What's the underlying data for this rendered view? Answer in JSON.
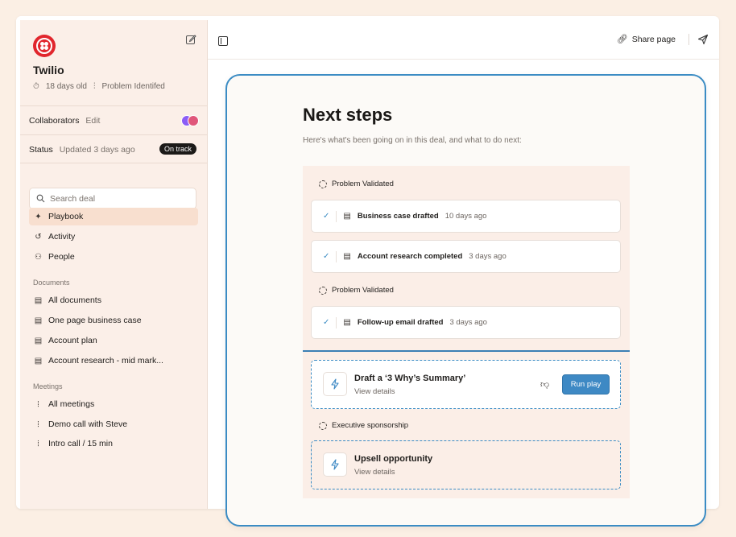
{
  "company": {
    "name": "Twilio",
    "age": "18 days old",
    "stage": "Problem Identifed"
  },
  "collaborators": {
    "label": "Collaborators",
    "edit": "Edit"
  },
  "status": {
    "label": "Status",
    "updated": "Updated 3 days ago",
    "badge": "On track"
  },
  "search": {
    "placeholder": "Search deal"
  },
  "nav": [
    {
      "label": "Playbook",
      "icon": "sparkle-icon"
    },
    {
      "label": "Activity",
      "icon": "history-icon"
    },
    {
      "label": "People",
      "icon": "person-icon"
    }
  ],
  "documents": {
    "heading": "Documents",
    "items": [
      "All documents",
      "One page business case",
      "Account plan",
      "Account research - mid mark..."
    ]
  },
  "meetings": {
    "heading": "Meetings",
    "items": [
      "All meetings",
      "Demo call with Steve",
      "Intro call / 15 min"
    ]
  },
  "topbar": {
    "share_label": "Share page"
  },
  "main": {
    "title": "Next steps",
    "subtitle": "Here's what's been going on in this deal, and what to do next:",
    "groups": [
      {
        "label": "Problem Validated"
      },
      {
        "label": "Problem Validated"
      },
      {
        "label": "Executive sponsorship"
      }
    ],
    "tasks": [
      {
        "title": "Business case drafted",
        "when": "10 days ago"
      },
      {
        "title": "Account research completed",
        "when": "3 days ago"
      },
      {
        "title": "Follow-up email drafted",
        "when": "3 days ago"
      }
    ],
    "plays": [
      {
        "title": "Draft a ‘3 Why’s Summary’",
        "link": "View details",
        "button": "Run play"
      },
      {
        "title": "Upsell opportunity",
        "link": "View details"
      }
    ]
  },
  "colors": {
    "accent": "#3e89c4",
    "brand": "#e1262d",
    "sidebar_bg": "#fbefe8"
  }
}
